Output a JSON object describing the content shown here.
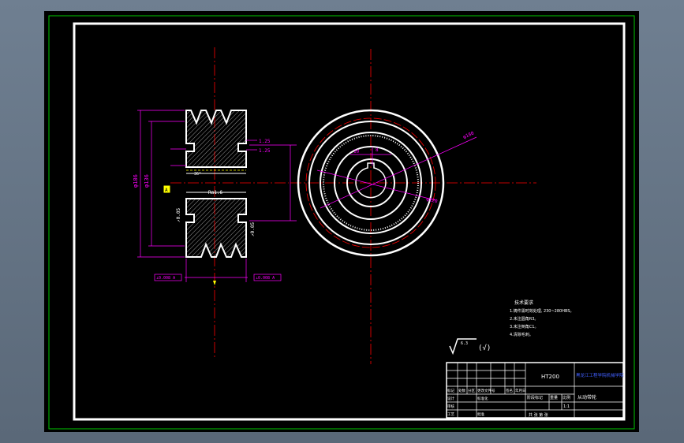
{
  "dimensions": {
    "left_view": {
      "diameter_outer": "φ186",
      "diameter_inner": "φ136",
      "groove_angle": "36°",
      "surface_note": "1.25",
      "surface_note_2": "1.25",
      "bore_note": "Ra1.6",
      "side_tolerance_left": "⊥0.008 A",
      "side_tolerance_right": "⊥0.008 A",
      "runout_left": "↗0.05",
      "runout_right": "↗0.05",
      "datum": "A"
    },
    "right_view": {
      "diameter_label_1": "φ180",
      "diameter_label_2": "φ120",
      "keyway_label": "8",
      "bore_label": "10"
    }
  },
  "technical_requirements": {
    "title": "技术要求",
    "items": [
      "1.铸件需时效处理, 230~280HBS。",
      "2.未注圆角R3。",
      "3.未注倒角C1。",
      "4.清除毛刺。"
    ]
  },
  "roughness_symbol": {
    "value": "6.3",
    "suffix": "(√)"
  },
  "title_block": {
    "material": "HT200",
    "school": "黑龙江工程学院机械学院",
    "part_name": "从动带轮",
    "scale": "1:1",
    "weight": "重量",
    "scale_label": "比例",
    "stage_label": "阶段标记",
    "sheet_label": "共 张 第 张",
    "row_labels": [
      "标记",
      "处数",
      "分区",
      "更改文件号",
      "签名",
      "年月日"
    ],
    "design_label": "设计",
    "check_label": "审核",
    "process_label": "工艺",
    "standard_label": "标准化",
    "approve_label": "批准"
  },
  "colors": {
    "background": "#000000",
    "frame": "#ffffff",
    "outer_frame": "#00c800",
    "dimension": "#ff00ff",
    "centerline": "#ff0000",
    "highlight": "#ffff00",
    "blue_text": "#0000ff"
  }
}
